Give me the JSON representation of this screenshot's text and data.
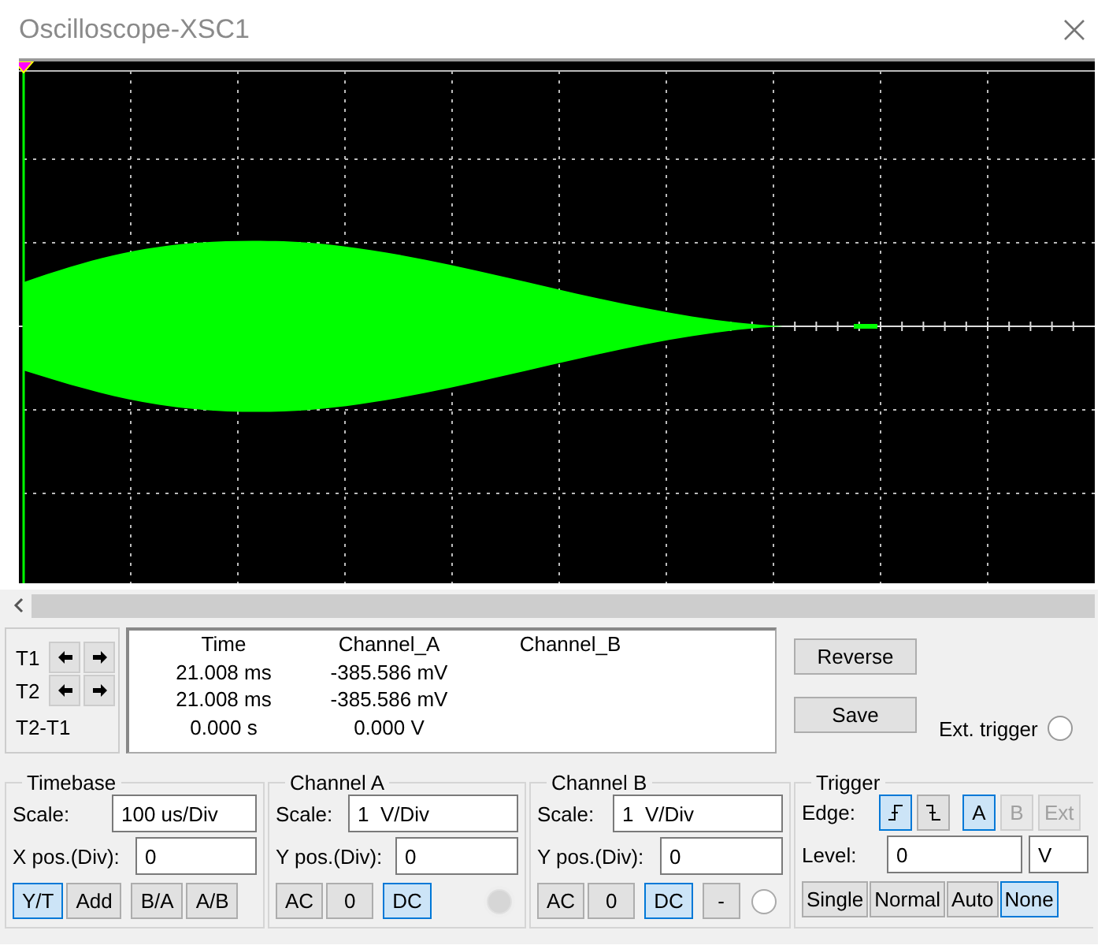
{
  "window": {
    "title": "Oscilloscope-XSC1"
  },
  "cursors": {
    "rows": [
      {
        "label": "T1"
      },
      {
        "label": "T2"
      }
    ],
    "diff_label": "T2-T1"
  },
  "readout": {
    "columns": [
      "Time",
      "Channel_A",
      "Channel_B"
    ],
    "rows": [
      [
        "21.008 ms",
        "-385.586 mV"
      ],
      [
        "21.008 ms",
        "-385.586 mV"
      ],
      [
        "0.000 s",
        "0.000 V"
      ]
    ]
  },
  "actions": [
    "Reverse",
    "Save"
  ],
  "ext_trigger": {
    "label": "Ext. trigger",
    "selected": false
  },
  "timebase": {
    "title": "Timebase",
    "scale": {
      "label": "Scale:",
      "value": "100 us/Div"
    },
    "position": {
      "label": "X pos.(Div):",
      "value": "0"
    },
    "modes": [
      {
        "label": "Y/T",
        "selected": true
      },
      {
        "label": "Add",
        "selected": false
      },
      {
        "label": "B/A",
        "selected": false
      },
      {
        "label": "A/B",
        "selected": false
      }
    ]
  },
  "channels": [
    {
      "title": "Channel A",
      "scale": {
        "label": "Scale:",
        "value": "1  V/Div"
      },
      "position": {
        "label": "Y pos.(Div):",
        "value": "0"
      },
      "coupling": [
        {
          "label": "AC",
          "selected": false
        },
        {
          "label": "0",
          "selected": false
        },
        {
          "label": "DC",
          "selected": true
        }
      ],
      "indicator": {
        "disabled": true
      }
    },
    {
      "title": "Channel B",
      "scale": {
        "label": "Scale:",
        "value": "1  V/Div"
      },
      "position": {
        "label": "Y pos.(Div):",
        "value": "0"
      },
      "coupling": [
        {
          "label": "AC",
          "selected": false
        },
        {
          "label": "0",
          "selected": false
        },
        {
          "label": "DC",
          "selected": true
        }
      ],
      "invert": {
        "label": "-",
        "selected": false
      },
      "indicator": {
        "disabled": false
      }
    }
  ],
  "trigger": {
    "title": "Trigger",
    "edge_label": "Edge:",
    "edges": [
      {
        "kind": "rising",
        "selected": true
      },
      {
        "kind": "falling",
        "selected": false
      }
    ],
    "sources": [
      {
        "label": "A",
        "selected": true,
        "disabled": false
      },
      {
        "label": "B",
        "selected": false,
        "disabled": true
      },
      {
        "label": "Ext",
        "selected": false,
        "disabled": true
      }
    ],
    "level": {
      "label": "Level:",
      "value": "0",
      "unit": "V"
    },
    "modes": [
      {
        "label": "Single",
        "selected": false
      },
      {
        "label": "Normal",
        "selected": false
      },
      {
        "label": "Auto",
        "selected": false
      },
      {
        "label": "None",
        "selected": true
      }
    ]
  }
}
